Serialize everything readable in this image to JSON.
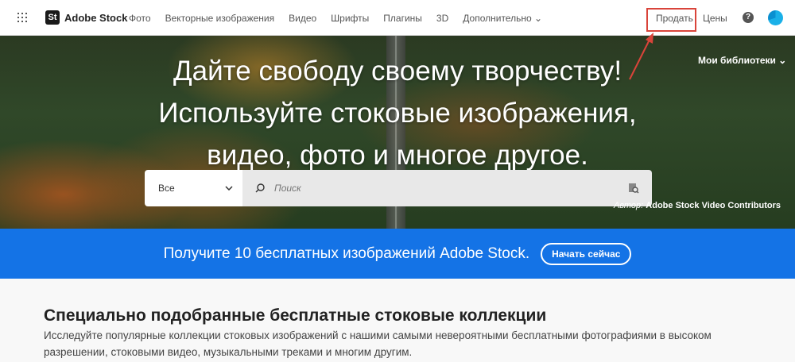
{
  "header": {
    "logo_badge": "St",
    "logo_text": "Adobe Stock",
    "nav": [
      "Фото",
      "Векторные изображения",
      "Видео",
      "Шрифты",
      "Плагины",
      "3D",
      "Дополнительно ⌄"
    ],
    "sell": "Продать",
    "pricing": "Цены",
    "help": "?"
  },
  "hero": {
    "title_lines": [
      "Дайте свободу своему творчеству!",
      "Используйте стоковые изображения,",
      "видео, фото и многое другое."
    ],
    "libraries": "Мои библиотеки ⌄",
    "credit_prefix": "Автор:",
    "credit_name": "Adobe Stock Video Contributors"
  },
  "search": {
    "category": "Все",
    "placeholder": "Поиск"
  },
  "promo": {
    "text": "Получите 10 бесплатных изображений Adobe Stock.",
    "button": "Начать сейчас",
    "color": "#1473e6"
  },
  "section": {
    "title": "Специально подобранные бесплатные стоковые коллекции",
    "description": "Исследуйте популярные коллекции стоковых изображений с нашими самыми невероятными бесплатными фотографиями в высоком разрешении, стоковыми видео, музыкальными треками и многим другим."
  },
  "annotation": {
    "color": "#d9443a"
  }
}
